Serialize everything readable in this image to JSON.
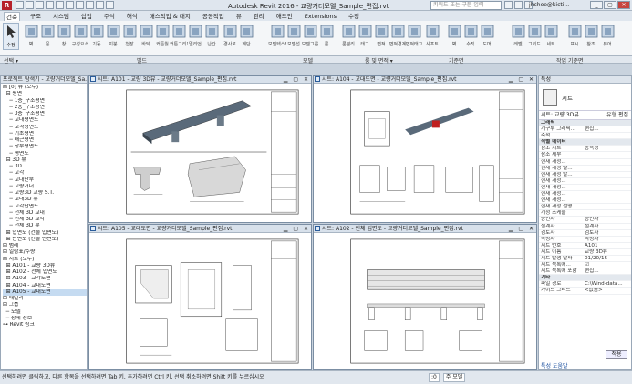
{
  "app": {
    "title": "Autodesk Revit 2016 - 교량거더모델_Sample_편집.rvt",
    "logo": "R",
    "search_placeholder": "키워드 또는 구문 입력",
    "user": "jhchoe@kicti..."
  },
  "ribbon": {
    "tabs": [
      "건축",
      "구조",
      "시스템",
      "삽입",
      "주석",
      "해석",
      "매스작업 & 대지",
      "공동작업",
      "뷰",
      "관리",
      "애드인",
      "Extensions",
      "수정"
    ],
    "active_tab": 0,
    "modify_label": "수정",
    "panels": [
      {
        "label": "선택 ▾"
      },
      {
        "label": "빌드"
      },
      {
        "label": "모델"
      },
      {
        "label": "룸 및 면적 ▾"
      },
      {
        "label": "기준면"
      },
      {
        "label": "작업 기준면"
      }
    ],
    "tools": [
      "벽",
      "문",
      "창",
      "구성요소",
      "기둥",
      "지붕",
      "천장",
      "바닥",
      "커튼월",
      "커튼그리드",
      "멀리언",
      "난간",
      "경사로",
      "계단",
      "모델텍스트",
      "모델선",
      "모델그룹",
      "룸",
      "룸분리",
      "태그",
      "면적",
      "면적경계",
      "면적태그",
      "샤프트",
      "벽",
      "수직",
      "도머",
      "레벨",
      "그리드",
      "세트",
      "표시",
      "참조",
      "뷰어"
    ]
  },
  "browser": {
    "header": "프로젝트 탐색기 - 교량거더모델_Sa...",
    "items": [
      {
        "label": "⊟ [0] 뷰 (모두)",
        "selected": false
      },
      {
        "label": "  ⊟ 평면",
        "selected": false
      },
      {
        "label": "    ─ 1층_구조평면",
        "selected": false
      },
      {
        "label": "    ─ 2층_구조평면",
        "selected": false
      },
      {
        "label": "    ─ 3층_구조평면",
        "selected": false
      },
      {
        "label": "    ─ 교대평면도",
        "selected": false
      },
      {
        "label": "    ─ 교각평면도",
        "selected": false
      },
      {
        "label": "    ─ 기초평면",
        "selected": false
      },
      {
        "label": "    ─ 배근평면",
        "selected": false
      },
      {
        "label": "    ─ 상부평면도",
        "selected": false
      },
      {
        "label": "    ─ 평면도",
        "selected": false
      },
      {
        "label": "  ⊟ 3D 뷰",
        "selected": false
      },
      {
        "label": "    ─ 3D",
        "selected": false
      },
      {
        "label": "    ─ 교각",
        "selected": false
      },
      {
        "label": "    ─ 교대단부",
        "selected": false
      },
      {
        "label": "    ─ 교량거더",
        "selected": false
      },
      {
        "label": "    ─ 교량3D 교량 S.T.",
        "selected": false
      },
      {
        "label": "    ─ 교대3D 뷰",
        "selected": false
      },
      {
        "label": "    ─ 교각단면도",
        "selected": false
      },
      {
        "label": "    ─ 전체 3D 교대",
        "selected": false
      },
      {
        "label": "    ─ 전체 3D 교각",
        "selected": false
      },
      {
        "label": "    ─ 전체 3D 뷰",
        "selected": false
      },
      {
        "label": "  ⊞ 입면도 (건물 입면도)",
        "selected": false
      },
      {
        "label": "  ⊞ 단면도 (건물 단면도)",
        "selected": false
      },
      {
        "label": "⊞ 범례",
        "selected": false
      },
      {
        "label": "⊞ 일람표/수량",
        "selected": false
      },
      {
        "label": "⊟ 시트 (모두)",
        "selected": false
      },
      {
        "label": "  ⊞ A101 - 교량 3D뷰",
        "selected": false
      },
      {
        "label": "  ⊞ A102 - 전체 입면도",
        "selected": false
      },
      {
        "label": "  ⊞ A103 - 교각도면",
        "selected": false
      },
      {
        "label": "  ⊞ A104 - 교대도면",
        "selected": false
      },
      {
        "label": "  ⊞ A105 - 교대도면",
        "selected": true
      },
      {
        "label": "⊞ 패밀리",
        "selected": false
      },
      {
        "label": "⊟ 그룹",
        "selected": false
      },
      {
        "label": "  ─ 모델",
        "selected": false
      },
      {
        "label": "  ─ 상세 정보",
        "selected": false
      },
      {
        "label": "⊶ Revit 링크",
        "selected": false
      }
    ]
  },
  "views": [
    {
      "title": "시트: A101 - 교량 3D뷰 - 교량거더모델_Sample_편집.rvt",
      "controls": "▁ ▢ ✕"
    },
    {
      "title": "시트: A104 - 교대도면 - 교량거더모델_Sample_편집.rvt",
      "controls": "▁ ▢ ✕"
    },
    {
      "title": "시트: A105 - 교대도면 - 교량거더모델_Sample_편집.rvt",
      "controls": "▁ ▢ ✕"
    },
    {
      "title": "시트: A102 - 전체 입면도 - 교량거더모델_Sample_편집.rvt",
      "controls": "▁ ▢ ✕"
    }
  ],
  "properties": {
    "header": "특성",
    "type_name": "시트",
    "filter_label": "시트: 교량 3D뷰",
    "edit_type": "유형 편집",
    "rows": [
      {
        "k": "그래픽",
        "v": "",
        "section": true
      },
      {
        "k": "개구부 그래픽...",
        "v": "편집...",
        "section": false
      },
      {
        "k": "축척",
        "v": "",
        "section": false
      },
      {
        "k": "식별 데이터",
        "v": "",
        "section": true
      },
      {
        "k": "참조 시트",
        "v": "종속성",
        "section": false
      },
      {
        "k": "참조 세부",
        "v": "",
        "section": false
      },
      {
        "k": "현재 개정...",
        "v": "",
        "section": false
      },
      {
        "k": "현재 개정 발...",
        "v": "",
        "section": false
      },
      {
        "k": "현재 개정 발...",
        "v": "",
        "section": false
      },
      {
        "k": "현재 개정...",
        "v": "",
        "section": false
      },
      {
        "k": "현재 개정...",
        "v": "",
        "section": false
      },
      {
        "k": "현재 개정...",
        "v": "",
        "section": false
      },
      {
        "k": "현재 개정...",
        "v": "",
        "section": false
      },
      {
        "k": "현재 개정 설명",
        "v": "",
        "section": false
      },
      {
        "k": "개정 스케줄",
        "v": "",
        "section": false
      },
      {
        "k": "승인자",
        "v": "승인자",
        "section": false
      },
      {
        "k": "설계자",
        "v": "설계자",
        "section": false
      },
      {
        "k": "검토자",
        "v": "검토자",
        "section": false
      },
      {
        "k": "작성자",
        "v": "작성자",
        "section": false
      },
      {
        "k": "시트 번호",
        "v": "A101",
        "section": false
      },
      {
        "k": "시트 이름",
        "v": "교량 3D뷰",
        "section": false
      },
      {
        "k": "시트 발행 날짜",
        "v": "01/20/15",
        "section": false
      },
      {
        "k": "시트 목록에...",
        "v": "☑",
        "section": false
      },
      {
        "k": "시트 목록에 포함",
        "v": "편집...",
        "section": false
      },
      {
        "k": "기타",
        "v": "",
        "section": true
      },
      {
        "k": "파일 경로",
        "v": "C:\\Wind-data...",
        "section": false
      },
      {
        "k": "가이드 그리드",
        "v": "<없음>",
        "section": false
      }
    ],
    "apply_label": "적용",
    "help_link": "특성 도움말"
  },
  "status": {
    "text": "선택하려면 클릭하고, 다른 항목을 선택하려면 Tab 키, 추가하려면 Ctrl 키, 선택 취소하려면 Shift 키를 누르십시오",
    "zero": ":0",
    "model": "주 모델"
  }
}
